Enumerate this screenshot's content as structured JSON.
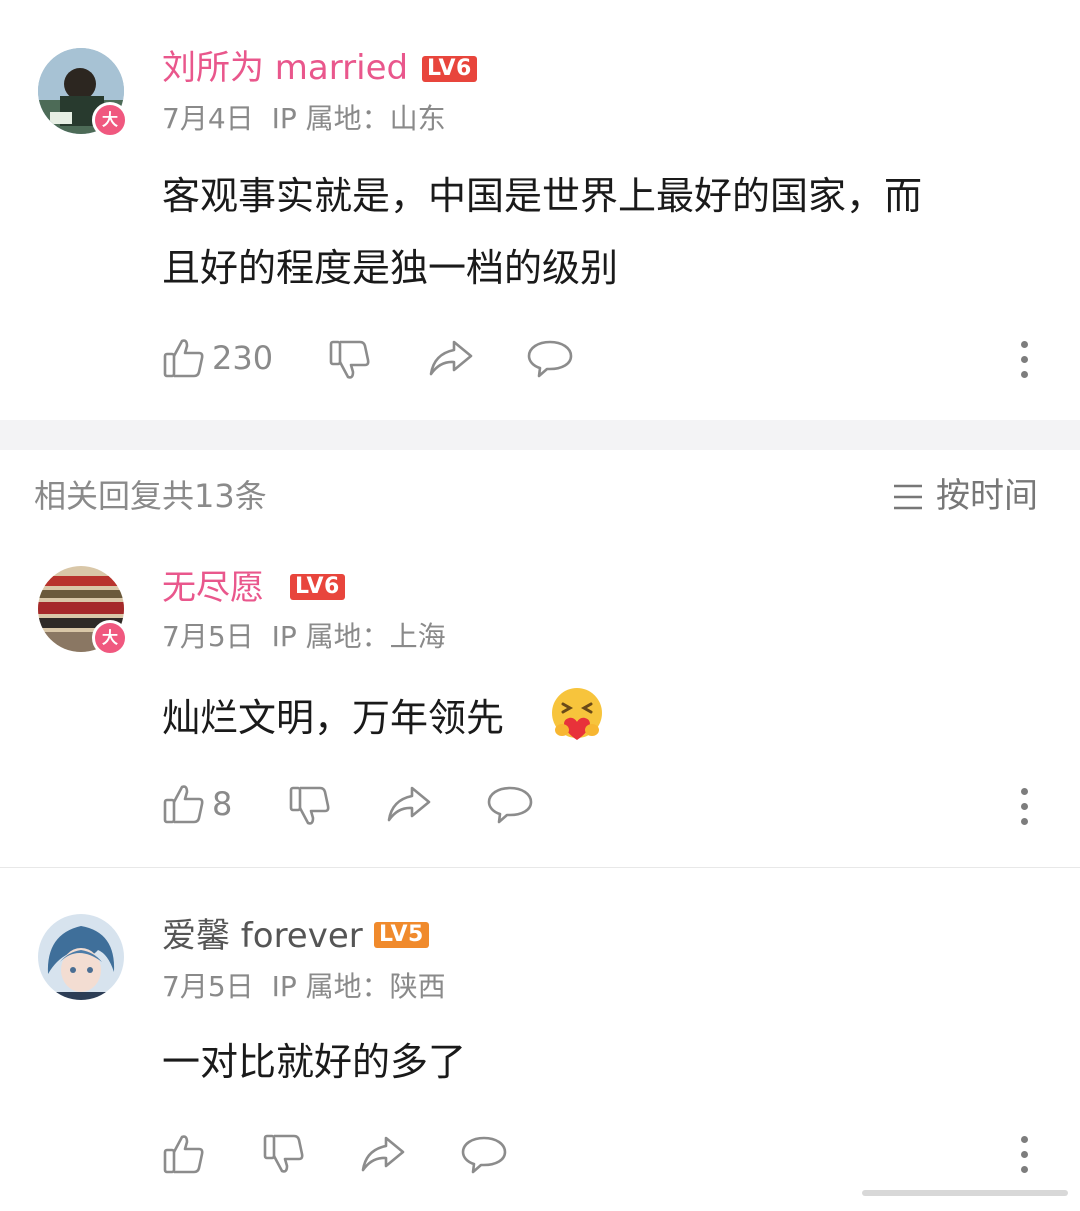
{
  "main_comment": {
    "username": "刘所为 married",
    "level": "LV6",
    "date": "7月4日",
    "ip_location": "IP 属地：山东",
    "text_line1": "客观事实就是，中国是世界上最好的国家，而",
    "text_line2": "且好的程度是独一档的级别",
    "likes": "230",
    "avatar_badge": "大"
  },
  "replies_header": {
    "title": "相关回复共13条",
    "sort_label": "按时间"
  },
  "replies": [
    {
      "username": "无尽愿",
      "level": "LV6",
      "date": "7月5日",
      "ip_location": "IP 属地：上海",
      "text": "灿烂文明，万年领先",
      "likes": "8",
      "avatar_badge": "大"
    },
    {
      "username": "爱馨 forever",
      "level": "LV5",
      "date": "7月5日",
      "ip_location": "IP 属地：陕西",
      "text": "一对比就好的多了"
    }
  ],
  "colors": {
    "username_pink": "#e9578c",
    "username_gray": "#555555",
    "lv6_red": "#e8453c",
    "lv5_orange": "#f08a2c",
    "icon_gray": "#8c8c8c"
  }
}
